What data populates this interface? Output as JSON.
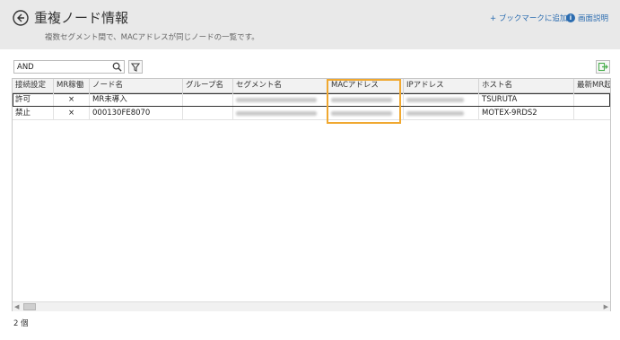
{
  "header": {
    "title": "重複ノード情報",
    "subtitle": "複数セグメント間で、MACアドレスが同じノードの一覧です。",
    "bookmark_label": "+ ブックマークに追加",
    "help_icon_glyph": "i",
    "help_label": "画面説明",
    "accent_color": "#2b6cb0"
  },
  "toolbar": {
    "search_value": "AND",
    "search_placeholder": ""
  },
  "table": {
    "columns": [
      "接続設定",
      "MR稼働",
      "ノード名",
      "グループ名",
      "セグメント名",
      "MACアドレス",
      "IPアドレス",
      "ホスト名",
      "最新MR起"
    ],
    "rows": [
      {
        "connection": "許可",
        "mr": "×",
        "node": "MR未導入",
        "group": "",
        "host": "TSURUTA"
      },
      {
        "connection": "禁止",
        "mr": "×",
        "node": "000130FE8070",
        "group": "",
        "host": "MOTEX-9RDS2"
      }
    ]
  },
  "footer": {
    "count": "2 個"
  },
  "highlight_color": "#f0a830"
}
